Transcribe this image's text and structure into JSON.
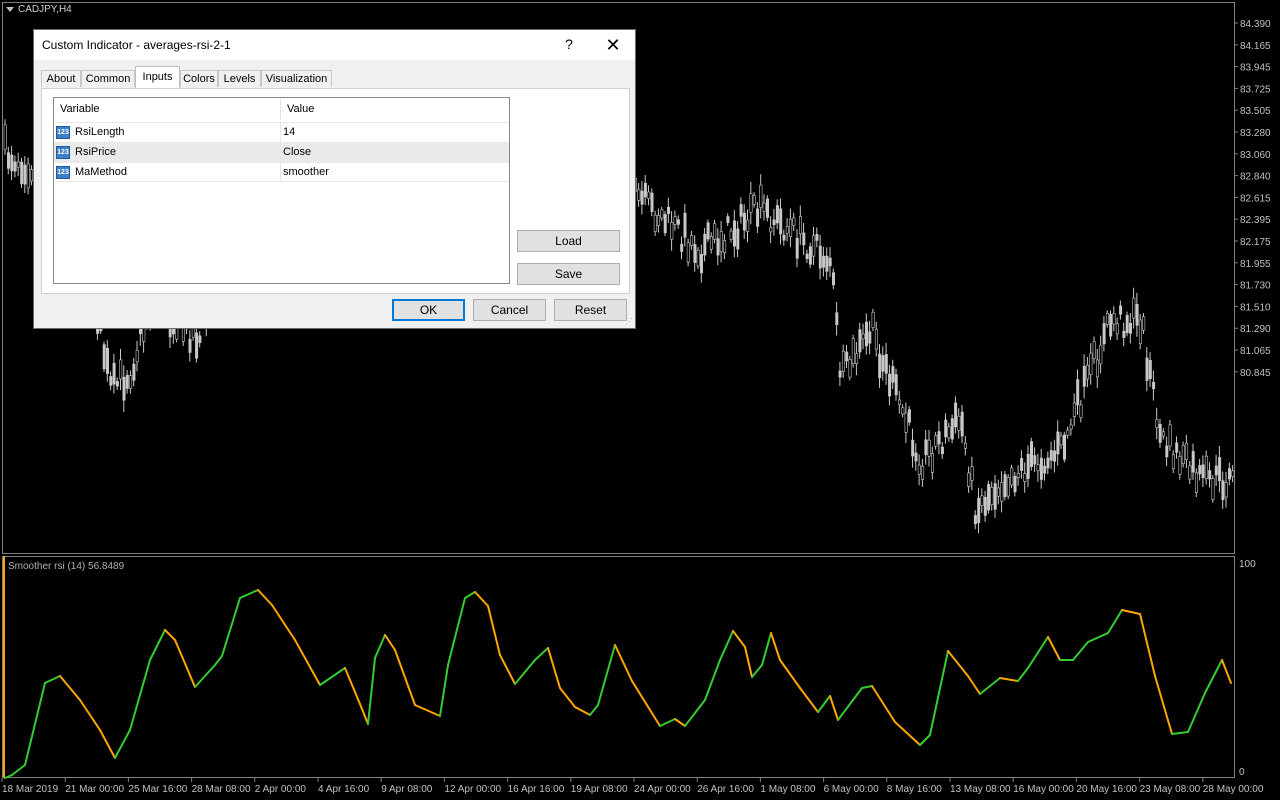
{
  "chart": {
    "title": "CADJPY,H4",
    "price_ticks": [
      "84.390",
      "84.165",
      "83.945",
      "83.725",
      "83.505",
      "83.280",
      "83.060",
      "82.840",
      "82.615",
      "82.395",
      "82.175",
      "81.955",
      "81.730",
      "81.510",
      "81.290",
      "81.065",
      "80.845"
    ],
    "date_ticks": [
      "18 Mar 2019",
      "21 Mar 00:00",
      "25 Mar 16:00",
      "28 Mar 08:00",
      "2 Apr 00:00",
      "4 Apr 16:00",
      "9 Apr 08:00",
      "12 Apr 00:00",
      "16 Apr 16:00",
      "19 Apr 08:00",
      "24 Apr 00:00",
      "26 Apr 16:00",
      "1 May 08:00",
      "6 May 00:00",
      "8 May 16:00",
      "13 May 08:00",
      "16 May 00:00",
      "20 May 16:00",
      "23 May 08:00",
      "28 May 00:00"
    ],
    "colors": {
      "background": "#000000",
      "candle": "#c8c8c8",
      "grid": "#808080",
      "rsi_up": "#32cd32",
      "rsi_down": "#ffa500"
    }
  },
  "subwindow": {
    "title": "Smoother rsi (14) 56.8489",
    "scale_max": "100",
    "scale_min": "0"
  },
  "dialog": {
    "title": "Custom Indicator - averages-rsi-2-1",
    "help_label": "?",
    "close_label": "✕",
    "tabs": [
      "About",
      "Common",
      "Inputs",
      "Colors",
      "Levels",
      "Visualization"
    ],
    "active_tab": "Inputs",
    "columns": [
      "Variable",
      "Value"
    ],
    "rows": [
      {
        "variable": "RsiLength",
        "value": "14"
      },
      {
        "variable": "RsiPrice",
        "value": "Close"
      },
      {
        "variable": "MaMethod",
        "value": "smoother"
      }
    ],
    "load_label": "Load",
    "save_label": "Save",
    "ok_label": "OK",
    "cancel_label": "Cancel",
    "reset_label": "Reset",
    "param_icon": "123"
  }
}
